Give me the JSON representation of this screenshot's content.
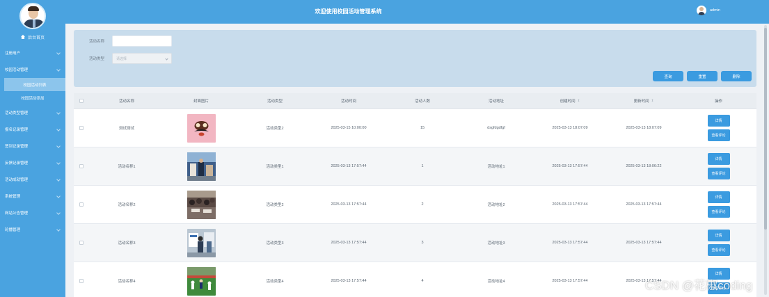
{
  "header": {
    "title": "欢迎使用校园活动管理系统",
    "username": "admin"
  },
  "sidebar": {
    "home_label": "后台首页",
    "items": [
      {
        "label": "注册用户",
        "has_arrow": true
      },
      {
        "label": "校园活动管理",
        "has_arrow": true,
        "expanded": true,
        "children": [
          {
            "label": "校园活动列表",
            "active": true
          },
          {
            "label": "校园活动添加",
            "active": false
          }
        ]
      },
      {
        "label": "活动类型管理",
        "has_arrow": true
      },
      {
        "label": "报名记录管理",
        "has_arrow": true
      },
      {
        "label": "签到记录管理",
        "has_arrow": true
      },
      {
        "label": "反馈记录管理",
        "has_arrow": true
      },
      {
        "label": "活动成就管理",
        "has_arrow": true
      },
      {
        "label": "系统管理",
        "has_arrow": true
      },
      {
        "label": "网站公告管理",
        "has_arrow": true
      },
      {
        "label": "轮播管理",
        "has_arrow": true
      }
    ]
  },
  "search": {
    "name_label": "活动名称",
    "name_placeholder": "",
    "type_label": "活动类型",
    "type_placeholder": "请选择",
    "buttons": {
      "query": "查询",
      "reset": "重置",
      "delete": "删除"
    }
  },
  "table": {
    "columns": {
      "name": "活动名称",
      "cover": "封面图片",
      "type": "活动类型",
      "time": "活动时间",
      "count": "活动人数",
      "address": "活动地址",
      "created": "创建时间",
      "updated": "更新时间",
      "ops": "操作"
    },
    "sort_icon": "⇕",
    "rows": [
      {
        "name": "测试测试",
        "type": "活动类型2",
        "time": "2025-03-15 10:00:00",
        "count": "15",
        "address": "dsgfdgdfgf",
        "created": "2025-03-13 18:07:09",
        "updated": "2025-03-13 18:07:09",
        "detail": "详情",
        "review": "查看评论",
        "image": "mustache-cartoon"
      },
      {
        "name": "活动名称1",
        "type": "活动类型1",
        "time": "2025-03-13 17:57:44",
        "count": "1",
        "address": "活动地址1",
        "created": "2025-03-13 17:57:44",
        "updated": "2025-03-13 18:06:22",
        "detail": "详情",
        "review": "查看评论",
        "image": "exhibition-photo"
      },
      {
        "name": "活动名称2",
        "type": "活动类型2",
        "time": "2025-03-13 17:57:44",
        "count": "2",
        "address": "活动地址2",
        "created": "2025-03-13 17:57:44",
        "updated": "2025-03-13 17:57:44",
        "detail": "详情",
        "review": "查看评论",
        "image": "crowd-photo"
      },
      {
        "name": "活动名称3",
        "type": "活动类型3",
        "time": "2025-03-13 17:57:44",
        "count": "3",
        "address": "活动地址3",
        "created": "2025-03-13 17:57:44",
        "updated": "2025-03-13 17:57:44",
        "detail": "详情",
        "review": "查看评论",
        "image": "booth-photo"
      },
      {
        "name": "活动名称4",
        "type": "活动类型4",
        "time": "2025-03-13 17:57:44",
        "count": "4",
        "address": "活动地址4",
        "created": "2025-03-13 17:57:44",
        "updated": "2025-03-13 17:57:44",
        "detail": "详情",
        "review": "查看评论",
        "image": "sports-field-photo"
      }
    ]
  },
  "watermark": "CSDN @花椒coding",
  "colors": {
    "primary": "#4aa3e0",
    "button": "#3b9be0",
    "panel": "#c8dcec"
  }
}
